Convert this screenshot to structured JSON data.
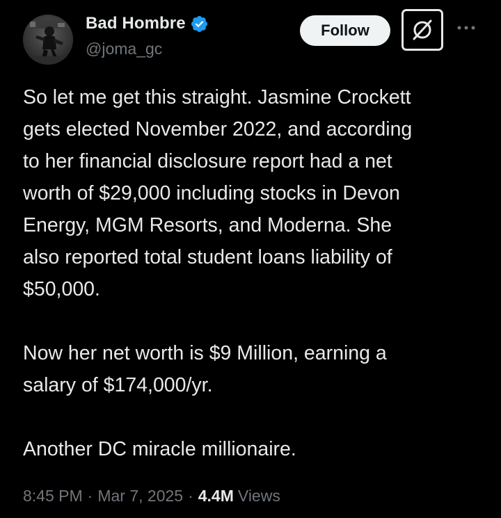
{
  "author": {
    "display_name": "Bad Hombre",
    "handle": "@joma_gc",
    "verified": true,
    "verified_color": "#1d9bf0",
    "avatar_icon": "profile-photo"
  },
  "actions": {
    "follow_label": "Follow",
    "grok_icon": "grok-icon",
    "more_icon": "more-options-icon"
  },
  "tweet": {
    "text": "So let me get this straight. Jasmine Crockett\ngets elected November 2022, and according\nto her financial disclosure report had a net\nworth of $29,000 including stocks in Devon\nEnergy, MGM Resorts, and Moderna. She\nalso reported total student loans liability of\n$50,000.\n\nNow her net worth is $9 Million, earning a\nsalary of $174,000/yr.\n\nAnother DC miracle millionaire."
  },
  "meta": {
    "time": "8:45 PM",
    "separator": "·",
    "date": "Mar 7, 2025",
    "views_count": "4.4M",
    "views_label": "Views"
  },
  "colors": {
    "background": "#000000",
    "primary_text": "#e7e9ea",
    "secondary_text": "#71767b",
    "follow_bg": "#eff3f4"
  }
}
